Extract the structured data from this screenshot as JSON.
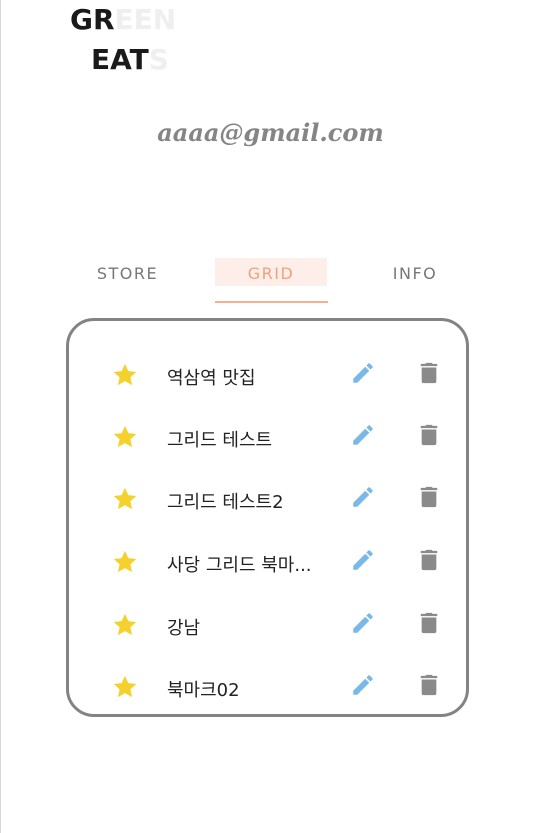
{
  "logo": {
    "line1": "GR",
    "line1_ghost": "EEN",
    "line2": "EAT",
    "line2_ghost": "S"
  },
  "user": {
    "email": "aaaa@gmail.com"
  },
  "tabs": [
    {
      "label": "STORE",
      "active": false
    },
    {
      "label": "GRID",
      "active": true
    },
    {
      "label": "INFO",
      "active": false
    }
  ],
  "grid_list": {
    "items": [
      {
        "name": "역삼역 맛집"
      },
      {
        "name": "그리드 테스트"
      },
      {
        "name": "그리드 테스트2"
      },
      {
        "name": "사당 그리드 북마..."
      },
      {
        "name": "강남"
      },
      {
        "name": "북마크02"
      }
    ]
  },
  "icons": {
    "favorite": "star-icon",
    "edit": "pencil-icon",
    "delete": "trash-icon"
  },
  "colors": {
    "star": "#f5d12e",
    "edit": "#7ab8e8",
    "delete": "#8a8a8a",
    "active_tab": "#f2a27a",
    "active_tab_bg": "#fdeeea",
    "panel_border": "#838383"
  }
}
